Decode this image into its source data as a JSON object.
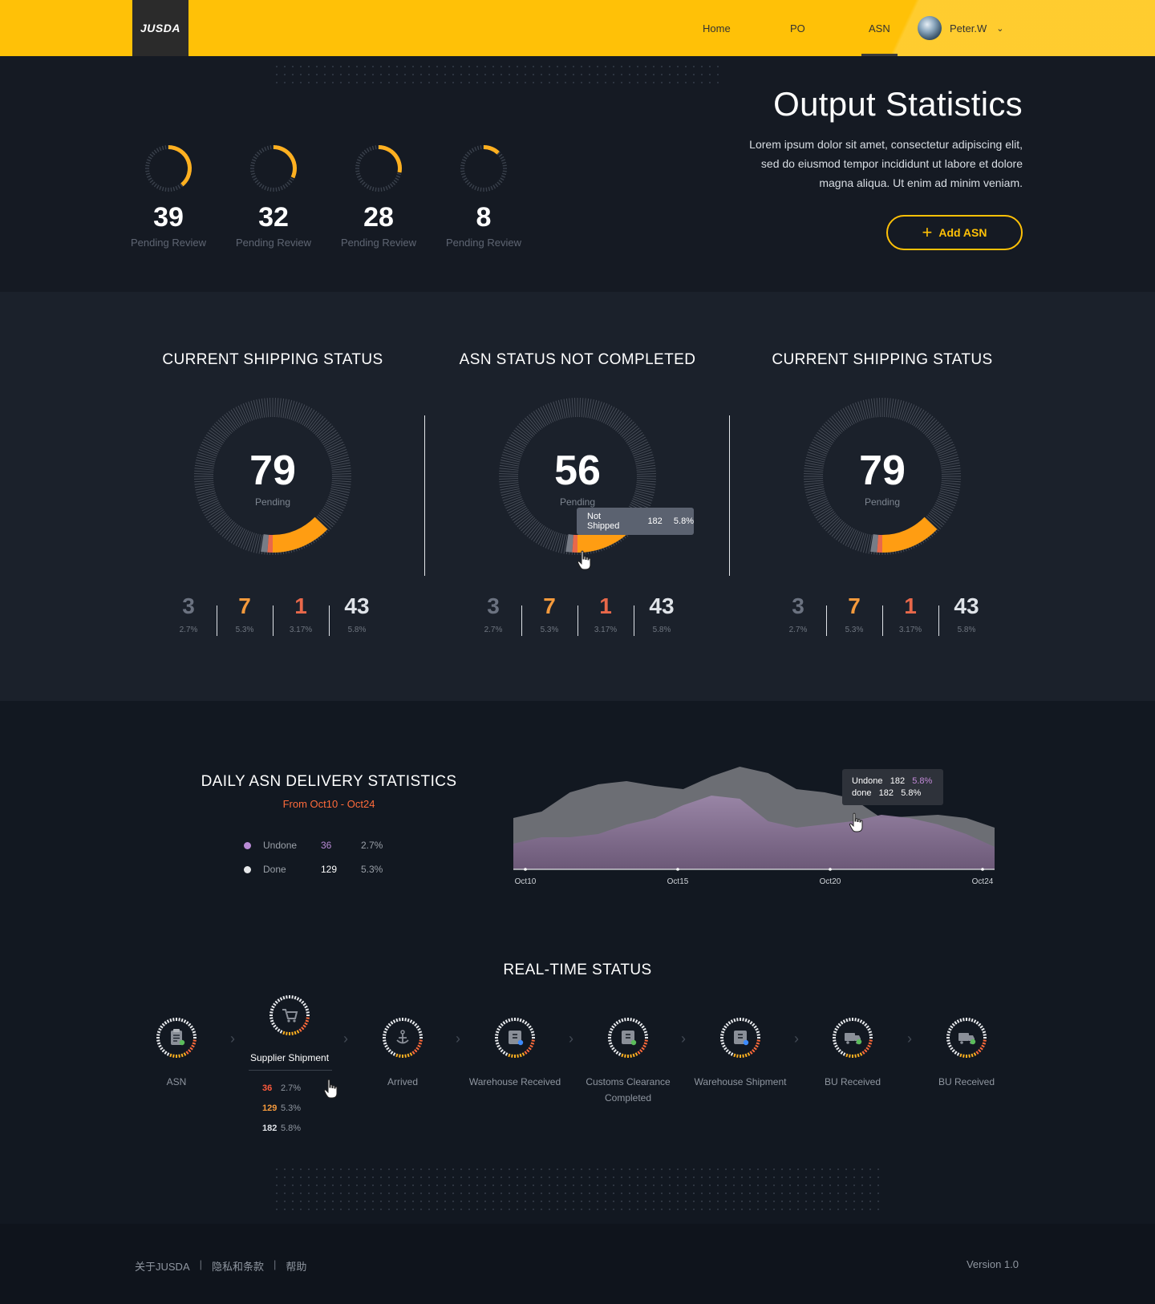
{
  "header": {
    "logo_text": "JUSDA",
    "nav": [
      {
        "label": "Home"
      },
      {
        "label": "PO"
      },
      {
        "label": "ASN",
        "active": true
      }
    ],
    "user_name": "Peter.W"
  },
  "hero": {
    "title": "Output Statistics",
    "description": "Lorem ipsum dolor sit amet, consectetur adipiscing elit, sed do eiusmod tempor incididunt ut labore et dolore magna aliqua. Ut enim ad minim veniam.",
    "add_button": "Add ASN",
    "mini_stats": [
      {
        "value": "39",
        "label": "Pending Review",
        "fill": 0.39
      },
      {
        "value": "32",
        "label": "Pending Review",
        "fill": 0.32
      },
      {
        "value": "28",
        "label": "Pending Review",
        "fill": 0.28
      },
      {
        "value": "8",
        "label": "Pending Review",
        "fill": 0.12
      }
    ]
  },
  "status_cards": [
    {
      "title": "CURRENT SHIPPING STATUS",
      "value": "79",
      "sub": "Pending",
      "stats": [
        {
          "value": "3",
          "pct": "2.7%"
        },
        {
          "value": "7",
          "pct": "5.3%"
        },
        {
          "value": "1",
          "pct": "3.17%"
        },
        {
          "value": "43",
          "pct": "5.8%"
        }
      ]
    },
    {
      "title": "ASN STATUS NOT COMPLETED",
      "value": "56",
      "sub": "Pending",
      "stats": [
        {
          "value": "3",
          "pct": "2.7%"
        },
        {
          "value": "7",
          "pct": "5.3%"
        },
        {
          "value": "1",
          "pct": "3.17%"
        },
        {
          "value": "43",
          "pct": "5.8%"
        }
      ]
    },
    {
      "title": "CURRENT SHIPPING STATUS",
      "value": "79",
      "sub": "Pending",
      "stats": [
        {
          "value": "3",
          "pct": "2.7%"
        },
        {
          "value": "7",
          "pct": "5.3%"
        },
        {
          "value": "1",
          "pct": "3.17%"
        },
        {
          "value": "43",
          "pct": "5.8%"
        }
      ]
    }
  ],
  "stat_colors": [
    "#6b7280",
    "#f59a3c",
    "#e8684a",
    "#dfe3e8"
  ],
  "donut_tooltip": {
    "label": "Not Shipped",
    "value": "182",
    "pct": "5.8%"
  },
  "daily": {
    "title": "DAILY ASN DELIVERY STATISTICS",
    "range": "From Oct10 - Oct24",
    "legend": [
      {
        "name": "Undone",
        "count": "36",
        "pct": "2.7%",
        "color": "#b98bd6"
      },
      {
        "name": "Done",
        "count": "129",
        "pct": "5.3%",
        "color": "#e6e8ea"
      }
    ],
    "tooltip": {
      "undone_label": "Undone",
      "undone_value": "182",
      "undone_pct": "5.8%",
      "done_label": "done",
      "done_value": "182",
      "done_pct": "5.8%"
    }
  },
  "chart_data": {
    "type": "area",
    "x_ticks": [
      "Oct10",
      "Oct15",
      "Oct20",
      "Oct24"
    ],
    "series": [
      {
        "name": "Done",
        "color": "#6c6e74",
        "values": [
          32,
          36,
          48,
          53,
          55,
          52,
          50,
          58,
          64,
          60,
          50,
          48,
          44,
          32,
          33,
          34,
          32,
          26
        ]
      },
      {
        "name": "Undone",
        "color": "#8b7596",
        "values": [
          16,
          20,
          20,
          22,
          28,
          32,
          40,
          46,
          44,
          30,
          26,
          28,
          30,
          34,
          32,
          28,
          22,
          14
        ]
      }
    ],
    "ylim": [
      0,
      70
    ]
  },
  "realtime": {
    "title": "REAL-TIME STATUS",
    "steps": [
      {
        "label": "ASN",
        "icon": "clipboard-icon"
      },
      {
        "label": "Supplier Shipment",
        "icon": "cart-icon",
        "active": true
      },
      {
        "label": "Arrived",
        "icon": "anchor-icon"
      },
      {
        "label": "Warehouse Received",
        "icon": "warehouse-icon"
      },
      {
        "label": "Customs Clearance Completed",
        "icon": "customs-icon"
      },
      {
        "label": "Warehouse Shipment",
        "icon": "warehouse-shipment-icon"
      },
      {
        "label": "BU Received",
        "icon": "truck-icon"
      },
      {
        "label": "BU Received",
        "icon": "truck-icon"
      }
    ],
    "popup": [
      {
        "value": "36",
        "pct": "2.7%",
        "color": "#ff5a3c"
      },
      {
        "value": "129",
        "pct": "5.3%",
        "color": "#f59a3c"
      },
      {
        "value": "182",
        "pct": "5.8%",
        "color": "#dfe3e8"
      }
    ]
  },
  "footer": {
    "links": [
      "关于JUSDA",
      "隐私和条款",
      "帮助"
    ],
    "version": "Version 1.0"
  }
}
